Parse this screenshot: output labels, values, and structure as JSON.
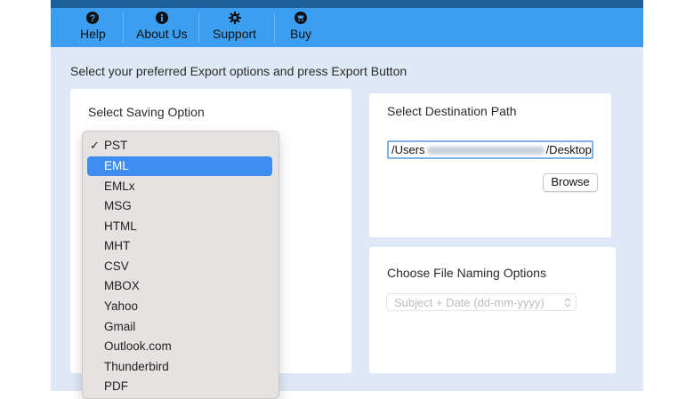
{
  "toolbar": {
    "items": [
      {
        "label": "Help",
        "icon": "question-icon"
      },
      {
        "label": "About Us",
        "icon": "info-icon"
      },
      {
        "label": "Support",
        "icon": "gear-icon"
      },
      {
        "label": "Buy",
        "icon": "cart-icon"
      }
    ]
  },
  "instruction": "Select your preferred Export options and press Export Button",
  "saving": {
    "title": "Select Saving Option",
    "checked": "PST",
    "highlighted": "EML",
    "options": [
      "PST",
      "EML",
      "EMLx",
      "MSG",
      "HTML",
      "MHT",
      "CSV",
      "MBOX",
      "Yahoo",
      "Gmail",
      "Outlook.com",
      "Thunderbird",
      "PDF"
    ]
  },
  "destination": {
    "title": "Select Destination Path",
    "path_prefix": "/Users",
    "path_suffix": "/Desktop",
    "browse_label": "Browse"
  },
  "naming": {
    "title": "Choose File Naming Options",
    "selected": "Subject + Date (dd-mm-yyyy)"
  },
  "colors": {
    "toolbar_bg": "#3b9ef0",
    "app_bg": "#dfe8f6",
    "highlight": "#3d8ef0"
  }
}
